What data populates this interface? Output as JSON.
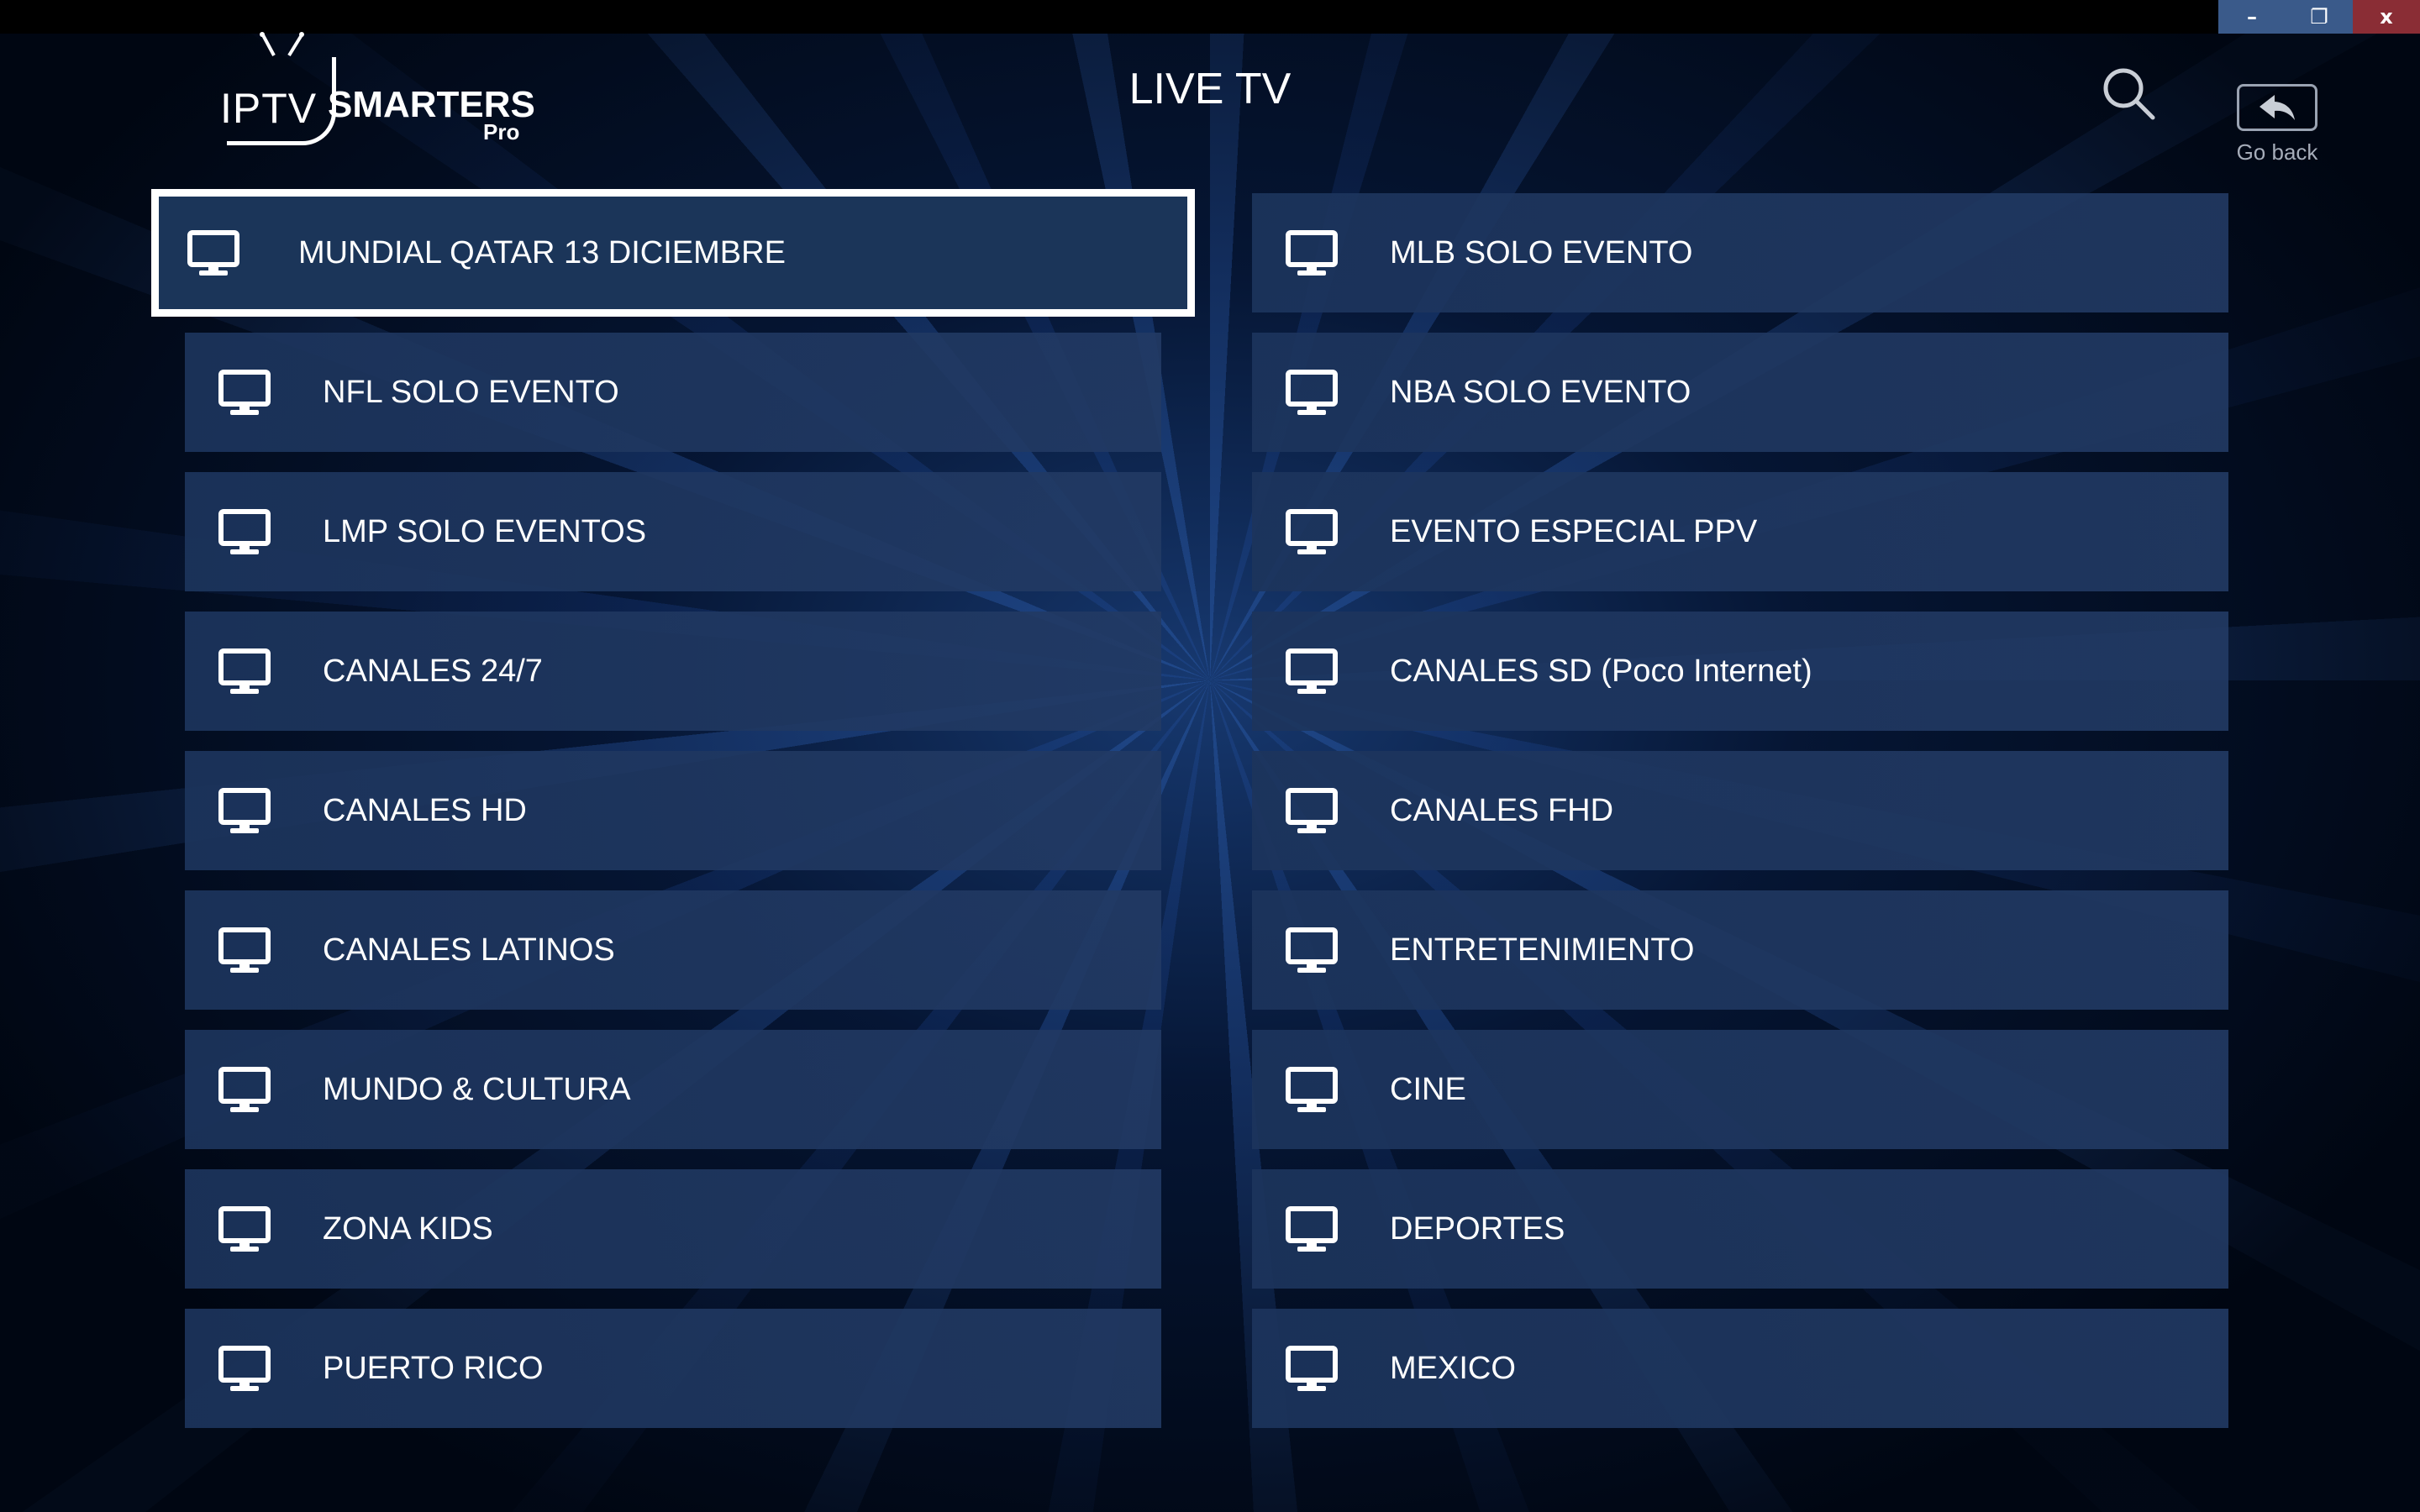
{
  "window": {
    "minimize_glyph": "–",
    "restore_glyph": "❐",
    "close_glyph": "x"
  },
  "header": {
    "logo": {
      "iptv": "IPTV",
      "smarters": "SMARTERS",
      "pro": "Pro"
    },
    "title": "LIVE TV",
    "go_back_label": "Go back"
  },
  "icons": {
    "search": "search-icon",
    "back": "back-arrow-icon",
    "category": "tv-monitor-icon"
  },
  "categories": {
    "left": [
      "MUNDIAL QATAR 13 DICIEMBRE",
      "NFL SOLO EVENTO",
      "LMP SOLO EVENTOS",
      "CANALES 24/7",
      "CANALES HD",
      "CANALES LATINOS",
      "MUNDO & CULTURA",
      "ZONA KIDS",
      "PUERTO RICO"
    ],
    "right": [
      "MLB SOLO EVENTO",
      "NBA SOLO EVENTO",
      "EVENTO ESPECIAL PPV",
      "CANALES SD (Poco Internet)",
      "CANALES FHD",
      "ENTRETENIMIENTO",
      "CINE",
      "DEPORTES",
      "MEXICO"
    ],
    "focused": "MUNDIAL QATAR 13 DICIEMBRE"
  },
  "colors": {
    "tile_bg": "#1f3a63",
    "focus_border": "#ffffff",
    "close_button": "#8a2d35",
    "window_buttons": "#3a5a8a"
  }
}
